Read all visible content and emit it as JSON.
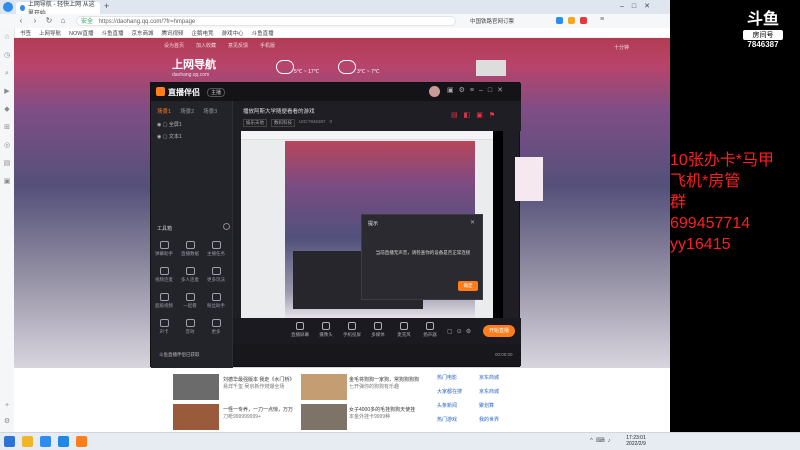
{
  "browser": {
    "tabs": [
      {
        "label": "上网导航 - 轻快上网 从这里开始"
      },
      {
        "label": "+"
      }
    ],
    "address": {
      "secure_label": "安全",
      "url": "https://daohang.qq.com/?fr=hmpage"
    },
    "search_hint": "中国铁路官网订票",
    "bookmarks": [
      "书签",
      "上网导航",
      "NOW直播",
      "斗鱼直播",
      "京东商城",
      "腾讯视频",
      "企鹅电竞",
      "游戏中心",
      "斗鱼直播"
    ]
  },
  "webpage": {
    "toplinks": [
      "设为首页",
      "加入收藏",
      "意见反馈",
      "手机版"
    ],
    "logo_text": "上网导航",
    "logo_sub": "daohang.qq.com",
    "weather": [
      {
        "temp": "5℃ ~ 17℃"
      },
      {
        "temp": "3℃ ~ 7℃"
      }
    ],
    "right_login": "十分钟",
    "news": [
      {
        "title": "刘德华最强版本 我走《水门桥》",
        "sub": "易烊千玺 吴京新作燃爆全场"
      },
      {
        "title": "金毛将狗狗一家狗，常狗狗狗狗",
        "sub": "七开弹你的狗狗有乐趣"
      },
      {
        "title": "一怪一专养，一刀一点惊，万万",
        "sub": "刀枪999999999+"
      },
      {
        "title": "女子4000多的毛挂狗狗天使挂",
        "sub": "本金外挂卡9999种"
      }
    ],
    "quicklinks": [
      "热门电影",
      "京东商城",
      "大家都在搜",
      "京东商城",
      "头条新闻",
      "聚划算",
      "热门游戏",
      "我的世界"
    ]
  },
  "app": {
    "title": "直播伴侣",
    "user_badge": "主播",
    "scene_tabs": [
      "场景1",
      "场景2",
      "场景3"
    ],
    "sources": [
      {
        "label": "全屏1"
      },
      {
        "label": "文本1"
      }
    ],
    "tools_title": "工具箱",
    "tools": [
      {
        "label": "弹幕助手"
      },
      {
        "label": "直播数据"
      },
      {
        "label": "主播任务"
      },
      {
        "label": "视频连麦"
      },
      {
        "label": "多人连麦"
      },
      {
        "label": "更多玩法"
      },
      {
        "label": "超级视频"
      },
      {
        "label": "一起看"
      },
      {
        "label": "粉丝助手"
      },
      {
        "label": "声卡"
      },
      {
        "label": "音效"
      },
      {
        "label": "更多"
      }
    ],
    "room_title": "播放阿斯大学随便看看的游戏",
    "room_tags": [
      "娱乐天地",
      "数码科技"
    ],
    "room_id": "UID:7846387",
    "viewers": "0",
    "dialog": {
      "header": "提示",
      "message": "当前直播无声音，请检查你的设备是否正常连接",
      "confirm": "确定"
    },
    "bottom_tools": [
      "直播屏幕",
      "摄像头",
      "手机投屏",
      "多媒体",
      "麦克风",
      "扬声器"
    ],
    "start_button": "开始直播",
    "status_left": "斗鱼直播伴侣已获取",
    "status_right": "00:00:00"
  },
  "overlay": {
    "logo_main": "斗鱼",
    "logo_sub": "房间号",
    "room_number": "7846387",
    "promo_lines": [
      "10张办卡*马甲",
      "飞机*房管",
      "群",
      "699457714",
      "yy16415"
    ]
  },
  "taskbar": {
    "time": "17:23:01",
    "date": "2022/2/9"
  },
  "colors": {
    "accent": "#ff7d1a",
    "promo": "#ff1e1e",
    "app_bg": "#1e1e24"
  }
}
